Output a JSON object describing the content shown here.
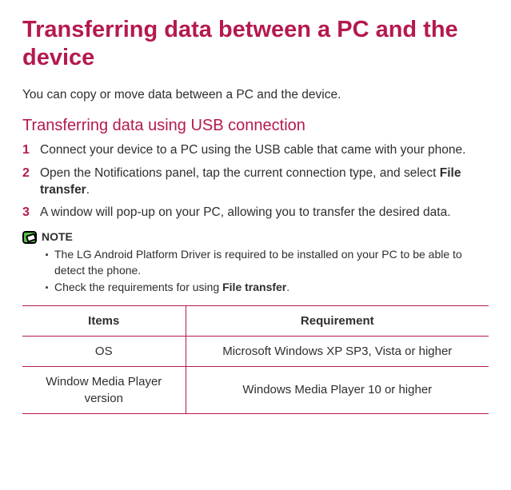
{
  "title": "Transferring data between a PC and the device",
  "intro": "You can copy or move data between a PC and the device.",
  "subheading": "Transferring data using USB connection",
  "steps": [
    {
      "num": "1",
      "text_a": "Connect your device to a PC using the USB cable that came with your phone."
    },
    {
      "num": "2",
      "text_a": "Open the Notifications panel, tap the current connection type, and select ",
      "bold": "File transfer",
      "text_b": "."
    },
    {
      "num": "3",
      "text_a": "A window will pop-up on your PC, allowing you to transfer the desired data."
    }
  ],
  "note": {
    "label": "NOTE",
    "items": [
      {
        "text_a": "The LG Android Platform Driver is required to be installed on your PC to be able to detect the phone."
      },
      {
        "text_a": "Check the requirements for using ",
        "bold": "File transfer",
        "text_b": "."
      }
    ]
  },
  "table": {
    "headers": [
      "Items",
      "Requirement"
    ],
    "rows": [
      {
        "item": "OS",
        "req": "Microsoft Windows XP SP3, Vista or higher"
      },
      {
        "item": "Window Media Player version",
        "req": "Windows Media Player 10 or higher"
      }
    ]
  }
}
